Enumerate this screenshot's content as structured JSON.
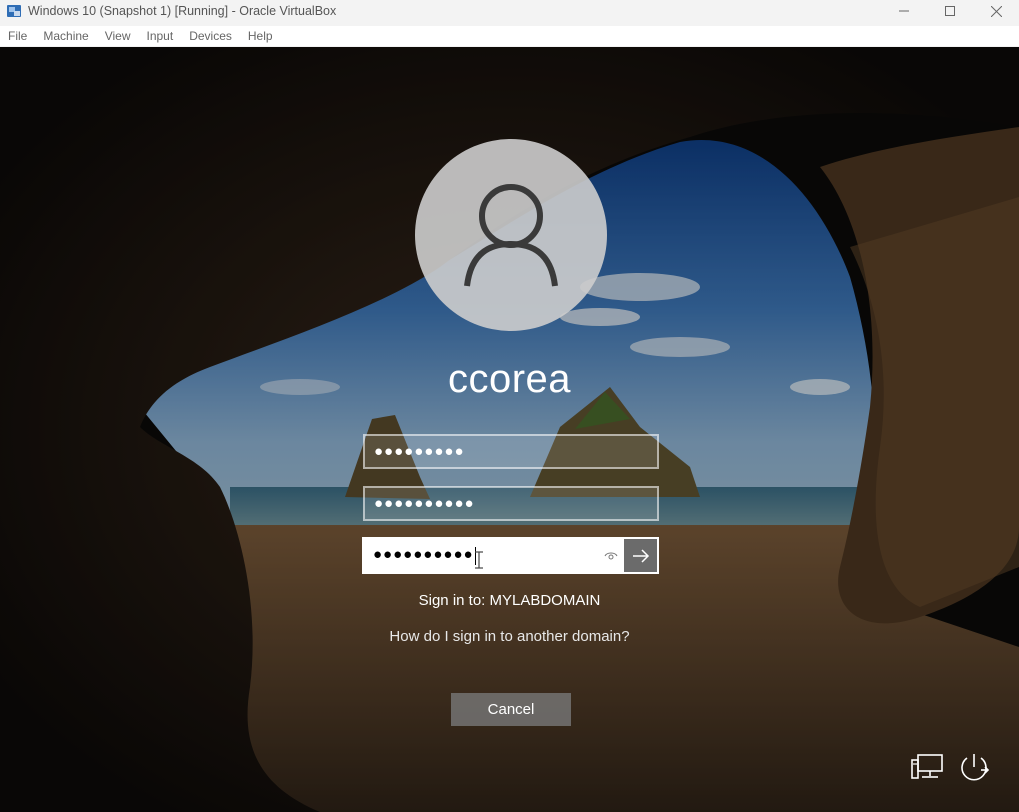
{
  "window": {
    "title": "Windows 10 (Snapshot 1) [Running] - Oracle VirtualBox",
    "app_icon": "virtualbox-icon",
    "controls": [
      "minimize-icon",
      "maximize-icon",
      "close-icon"
    ]
  },
  "menu": {
    "items": [
      "File",
      "Machine",
      "View",
      "Input",
      "Devices",
      "Help"
    ]
  },
  "login": {
    "username": "ccorea",
    "field_user_value": "●●●●●●●●●",
    "field_pass1_value": "●●●●●●●●●●",
    "field_pass2_value": "●●●●●●●●●●",
    "sign_in_to": "Sign in to: MYLABDOMAIN",
    "other_domain_link": "How do I sign in to another domain?",
    "cancel_label": "Cancel"
  },
  "icons": {
    "avatar": "user-avatar-icon",
    "reveal": "reveal-password-icon",
    "submit": "arrow-right-icon",
    "network": "network-icon",
    "power": "power-icon"
  },
  "colors": {
    "accent_submit": "#6b6b6b",
    "text_light": "#ffffff"
  }
}
